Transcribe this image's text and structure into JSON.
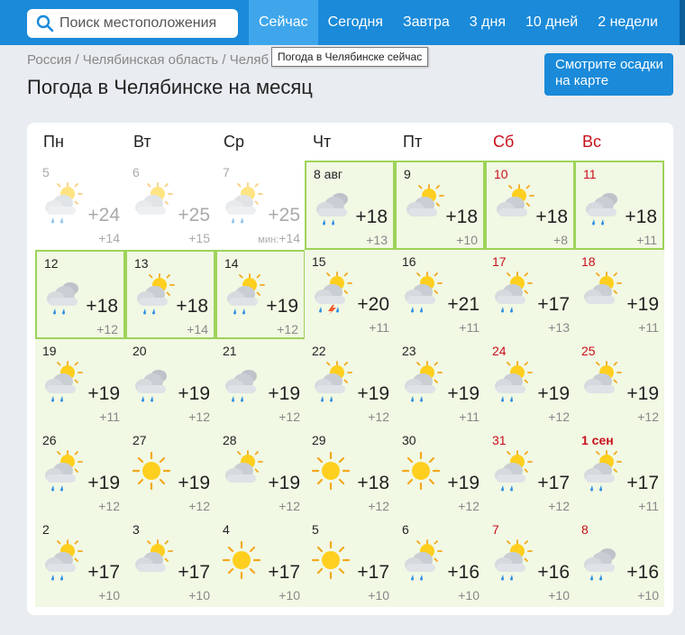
{
  "search": {
    "placeholder": "Поиск местоположения"
  },
  "nav": [
    "Сейчас",
    "Сегодня",
    "Завтра",
    "3 дня",
    "10 дней",
    "2 недели"
  ],
  "tooltip": "Погода в Челябинске сейчас",
  "breadcrumb": "Россия / Челябинская область / Челяб",
  "title": "Погода в Челябинске на месяц",
  "map_button": "Смотрите осадки на карте",
  "colors": {
    "brand": "#1a8ad9",
    "active_tab": "#3fa6ec",
    "weekend": "#c8101a",
    "cell_bg": "#f1f8e4",
    "current_border": "#9ed35a"
  },
  "weekdays": [
    "Пн",
    "Вт",
    "Ср",
    "Чт",
    "Пт",
    "Сб",
    "Вс"
  ],
  "weeks": [
    [
      {
        "date": "5",
        "icon": "rain-sun-icon",
        "max": "+24",
        "min": "+14",
        "past": true
      },
      {
        "date": "6",
        "icon": "cloud-sun-icon",
        "max": "+25",
        "min": "+15",
        "past": true
      },
      {
        "date": "7",
        "icon": "rain-sun-icon",
        "max": "+25",
        "min": "+14",
        "min_label": "мин:",
        "past": true
      },
      {
        "date": "8 авг",
        "icon": "rain-cloud-icon",
        "max": "+18",
        "min": "+13",
        "current": true
      },
      {
        "date": "9",
        "icon": "cloud-sun-icon",
        "max": "+18",
        "min": "+10",
        "current": true
      },
      {
        "date": "10",
        "icon": "cloud-sun-icon",
        "max": "+18",
        "min": "+8",
        "current": true
      },
      {
        "date": "11",
        "icon": "rain-cloud-icon",
        "max": "+18",
        "min": "+11",
        "current": true
      }
    ],
    [
      {
        "date": "12",
        "icon": "rain-cloud-icon",
        "max": "+18",
        "min": "+12",
        "current": true
      },
      {
        "date": "13",
        "icon": "rain-sun-icon",
        "max": "+18",
        "min": "+14",
        "current": true
      },
      {
        "date": "14",
        "icon": "rain-sun-icon",
        "max": "+19",
        "min": "+12",
        "current": true
      },
      {
        "date": "15",
        "icon": "storm-sun-icon",
        "max": "+20",
        "min": "+11"
      },
      {
        "date": "16",
        "icon": "rain-sun-icon",
        "max": "+21",
        "min": "+11"
      },
      {
        "date": "17",
        "icon": "rain-sun-icon",
        "max": "+17",
        "min": "+13"
      },
      {
        "date": "18",
        "icon": "cloud-sun-icon",
        "max": "+19",
        "min": "+11"
      }
    ],
    [
      {
        "date": "19",
        "icon": "rain-sun-icon",
        "max": "+19",
        "min": "+11"
      },
      {
        "date": "20",
        "icon": "rain-cloud-icon",
        "max": "+19",
        "min": "+12"
      },
      {
        "date": "21",
        "icon": "rain-cloud-icon",
        "max": "+19",
        "min": "+12"
      },
      {
        "date": "22",
        "icon": "rain-sun-icon",
        "max": "+19",
        "min": "+12"
      },
      {
        "date": "23",
        "icon": "rain-sun-icon",
        "max": "+19",
        "min": "+11"
      },
      {
        "date": "24",
        "icon": "rain-sun-icon",
        "max": "+19",
        "min": "+12"
      },
      {
        "date": "25",
        "icon": "cloud-sun-icon",
        "max": "+19",
        "min": "+12"
      }
    ],
    [
      {
        "date": "26",
        "icon": "rain-sun-icon",
        "max": "+19",
        "min": "+12"
      },
      {
        "date": "27",
        "icon": "sun-icon",
        "max": "+19",
        "min": "+12"
      },
      {
        "date": "28",
        "icon": "cloud-sun-icon",
        "max": "+19",
        "min": "+12"
      },
      {
        "date": "29",
        "icon": "sun-icon",
        "max": "+18",
        "min": "+12"
      },
      {
        "date": "30",
        "icon": "sun-icon",
        "max": "+19",
        "min": "+12"
      },
      {
        "date": "31",
        "icon": "rain-sun-icon",
        "max": "+17",
        "min": "+12"
      },
      {
        "date": "1 сен",
        "icon": "rain-sun-icon",
        "max": "+17",
        "min": "+11",
        "bold": true
      }
    ],
    [
      {
        "date": "2",
        "icon": "rain-sun-icon",
        "max": "+17",
        "min": "+10"
      },
      {
        "date": "3",
        "icon": "cloud-sun-icon",
        "max": "+17",
        "min": "+10"
      },
      {
        "date": "4",
        "icon": "sun-icon",
        "max": "+17",
        "min": "+10"
      },
      {
        "date": "5",
        "icon": "sun-icon",
        "max": "+17",
        "min": "+10"
      },
      {
        "date": "6",
        "icon": "rain-sun-icon",
        "max": "+16",
        "min": "+10"
      },
      {
        "date": "7",
        "icon": "rain-sun-icon",
        "max": "+16",
        "min": "+10"
      },
      {
        "date": "8",
        "icon": "rain-cloud-icon",
        "max": "+16",
        "min": "+10"
      }
    ]
  ]
}
